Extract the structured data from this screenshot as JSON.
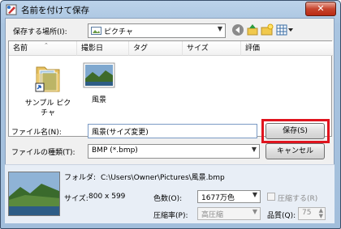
{
  "window": {
    "title": "名前を付けて保存",
    "close_glyph": "✕"
  },
  "location": {
    "label": "保存する場所(I):",
    "value": "ピクチャ"
  },
  "columns": [
    "名前",
    "撮影日",
    "タグ",
    "サイズ",
    "評価"
  ],
  "items": [
    {
      "label": "サンプル ピクチャ",
      "icon": "folder-icon"
    },
    {
      "label": "風景",
      "icon": "image-icon"
    }
  ],
  "filename": {
    "label": "ファイル名(N):",
    "value": "風景(サイズ変更)"
  },
  "filetype": {
    "label": "ファイルの種類(T):",
    "value": "BMP (*.bmp)"
  },
  "buttons": {
    "save": "保存(S)",
    "cancel": "キャンセル"
  },
  "details": {
    "folder_label": "フォルダ:",
    "folder_value": "C:\\Users\\Owner\\Pictures\\風景.bmp",
    "size_label": "サイズ:",
    "size_value": "800 x 599",
    "color_label": "色数(O):",
    "color_value": "1677万色",
    "compress_check_label": "圧縮する(R)",
    "ratio_label": "圧縮率(P):",
    "ratio_value": "高圧縮",
    "quality_label": "品質(Q):",
    "quality_value": "75"
  },
  "colors": {
    "highlight": "#e0141e",
    "info_bg": "#e8eef6"
  }
}
